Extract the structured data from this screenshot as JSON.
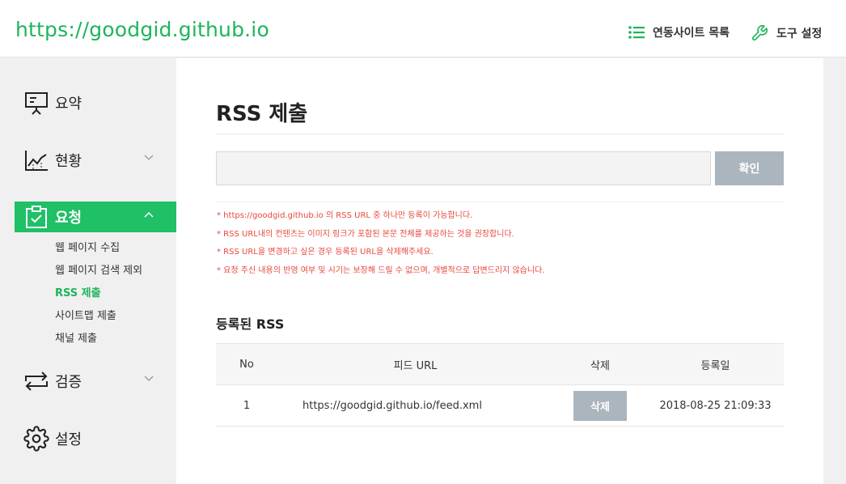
{
  "header": {
    "site_title": "https://goodgid.github.io",
    "links": {
      "sites": "연동사이트 목록",
      "tools": "도구 설정"
    }
  },
  "sidebar": {
    "items": [
      {
        "label": "요약",
        "icon": "presentation-icon"
      },
      {
        "label": "현황",
        "icon": "chart-line-icon"
      },
      {
        "label": "요청",
        "icon": "clipboard-check-icon"
      },
      {
        "label": "검증",
        "icon": "repeat-arrows-icon"
      },
      {
        "label": "설정",
        "icon": "gear-icon"
      }
    ],
    "subitems": [
      "웹 페이지 수집",
      "웹 페이지 검색 제외",
      "RSS 제출",
      "사이트맵 제출",
      "채널 제출"
    ]
  },
  "main": {
    "title": "RSS 제출",
    "input_value": "",
    "confirm_label": "확인",
    "notes": [
      "* https://goodgid.github.io 의 RSS URL 중 하나만 등록이 가능합니다.",
      "* RSS URL내의 컨텐츠는 이미지 링크가 포함된 본문 전체를 제공하는 것을 권장합니다.",
      "* RSS URL을 변경하고 싶은 경우 등록된 URL을 삭제해주세요.",
      "* 요청 주신 내용의 반영 여부 및 시기는 보장해 드릴 수 없으며, 개별적으로 답변드리지 않습니다."
    ],
    "section_title": "등록된 RSS",
    "table": {
      "headers": [
        "No",
        "피드 URL",
        "삭제",
        "등록일"
      ],
      "rows": [
        {
          "no": "1",
          "url": "https://goodgid.github.io/feed.xml",
          "delete": "삭제",
          "date": "2018-08-25 21:09:33"
        }
      ]
    }
  },
  "colors": {
    "brand": "#1fb45d",
    "active_bg": "#1fc066",
    "note": "#e8473c",
    "button": "#abb5be"
  }
}
